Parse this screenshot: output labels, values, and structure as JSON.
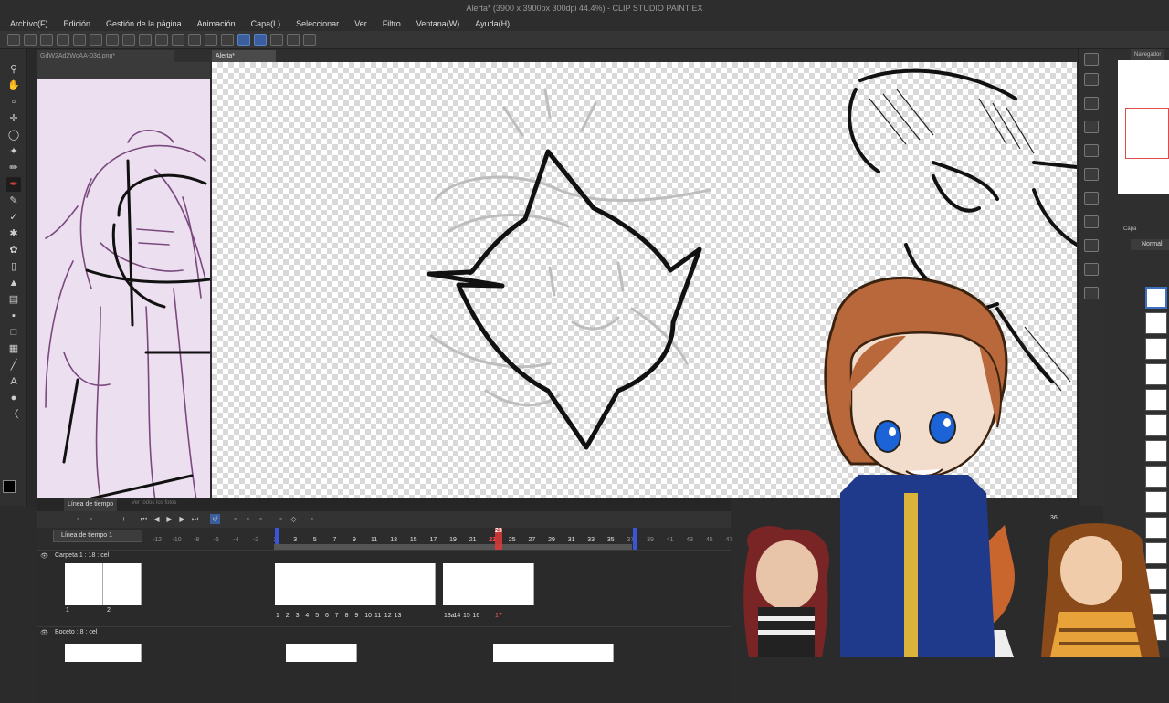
{
  "window": {
    "title": "Alerta* (3900 x 3900px 300dpi 44.4%) - CLIP STUDIO PAINT EX"
  },
  "menu": [
    "Archivo(F)",
    "Edición",
    "Gestión de la página",
    "Animación",
    "Capa(L)",
    "Seleccionar",
    "Ver",
    "Filtro",
    "Ventana(W)",
    "Ayuda(H)"
  ],
  "tabs": {
    "reference": "GdW2Ad2WcAA-03d.png*",
    "main": "Alerta*"
  },
  "navigator": {
    "label": "Navegador"
  },
  "layers": {
    "tab_label": "Capa",
    "blend_mode": "Normal"
  },
  "timeline": {
    "tab_label": "Línea de tiempo",
    "tab2_label": "Ver todos los fotos",
    "selector": "Línea de tiempo 1",
    "rows": [
      {
        "name": "Carpeta 1 : 18 : cel",
        "cells": [
          "1",
          "2"
        ]
      },
      {
        "name": "Boceto : 8 : cel",
        "cells": []
      }
    ],
    "frame_labels_row1": [
      "1",
      "2",
      "3",
      "4",
      "5",
      "6",
      "7",
      "8",
      "9",
      "10",
      "11",
      "12",
      "13"
    ],
    "frame_labels_row2": [
      "13a",
      "14",
      "15",
      "16"
    ],
    "current_frame": "23",
    "highlight_frame": "17",
    "end_label": "36",
    "ruler": [
      "-12",
      "-10",
      "-8",
      "-6",
      "-4",
      "-2",
      "1",
      "3",
      "5",
      "7",
      "9",
      "11",
      "13",
      "15",
      "17",
      "19",
      "21",
      "23",
      "25",
      "27",
      "29",
      "31",
      "33",
      "35",
      "37",
      "39",
      "41",
      "43",
      "45",
      "47"
    ]
  },
  "colors": {
    "accent": "#3d6fc4",
    "current_frame": "#e03a3a",
    "brush": "#d93b3b"
  }
}
